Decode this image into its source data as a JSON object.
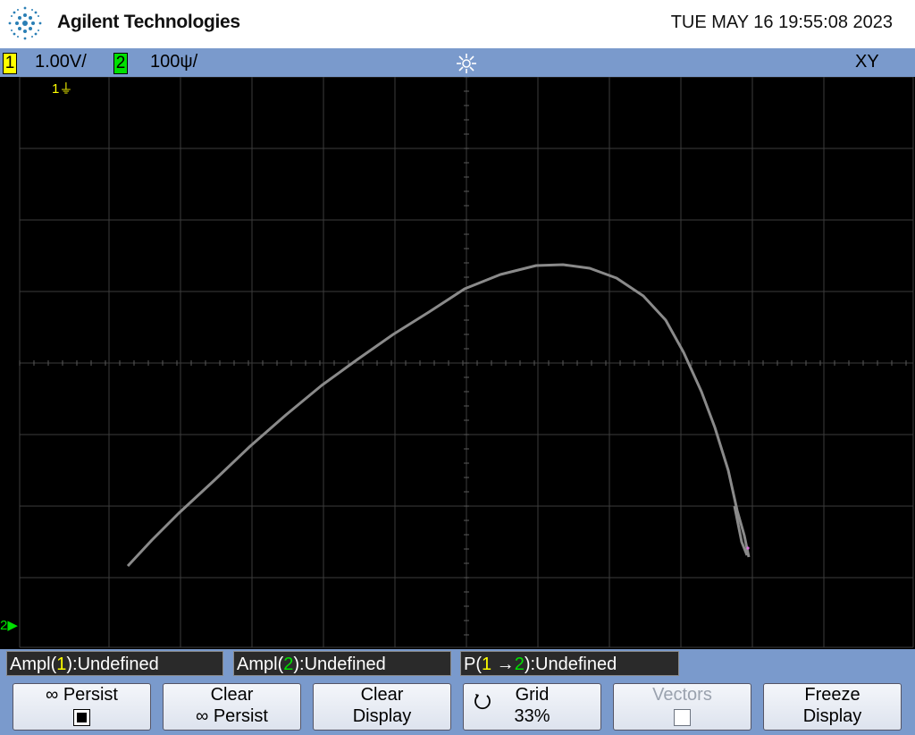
{
  "header": {
    "brand": "Agilent Technologies",
    "datetime": "TUE MAY 16 19:55:08 2023"
  },
  "status": {
    "ch1_num": "1",
    "ch1_scale": "1.00V/",
    "ch2_num": "2",
    "ch2_scale": "100ψ/",
    "acquire_icon": "acquisition-run-icon",
    "mode": "XY"
  },
  "screen": {
    "ch1_marker": "1",
    "ch2_marker": "2",
    "trace_color": "#8a8a8a",
    "ch1_color": "#ffff00",
    "ch2_color": "#00e000"
  },
  "measurements": [
    {
      "prefix": "Ampl(",
      "ch": "1",
      "suffix": "):Undefined"
    },
    {
      "prefix": "Ampl(",
      "ch": "2",
      "suffix": "):Undefined"
    },
    {
      "prefix": "P(",
      "ch_from": "1",
      "arrow": " →",
      "ch_to": "2",
      "suffix": "):Undefined"
    }
  ],
  "softkeys": [
    {
      "line1": "∞ Persist",
      "checkbox": "checked"
    },
    {
      "line1": "Clear",
      "line2": "∞ Persist"
    },
    {
      "line1": "Clear",
      "line2": "Display"
    },
    {
      "line1": "Grid",
      "line2": "33%",
      "icon": "rotate-knob-icon"
    },
    {
      "line1": "Vectors",
      "checkbox": "unchecked",
      "disabled": true
    },
    {
      "line1": "Freeze",
      "line2": "Display"
    }
  ]
}
